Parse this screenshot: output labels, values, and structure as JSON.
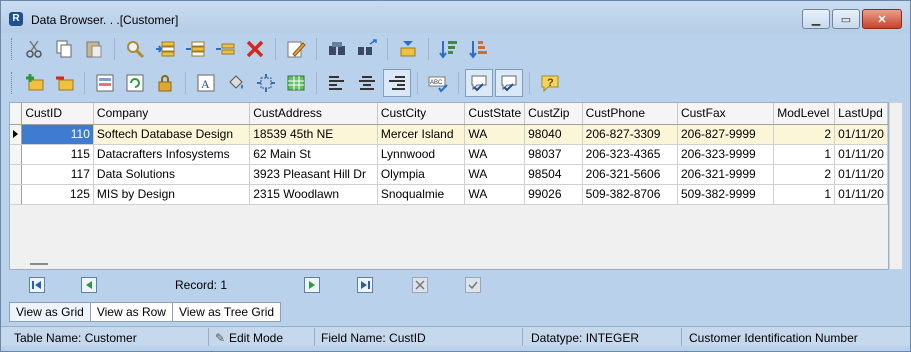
{
  "window": {
    "title": "Data Browser. . .[Customer]"
  },
  "grid": {
    "columns": [
      "CustID",
      "Company",
      "CustAddress",
      "CustCity",
      "CustState",
      "CustZip",
      "CustPhone",
      "CustFax",
      "ModLevel",
      "LastUpd"
    ],
    "rows": [
      [
        "110",
        "Softech Database Design",
        "18539 45th NE",
        "Mercer Island",
        "WA",
        "98040",
        "206-827-3309",
        "206-827-9999",
        "2",
        "01/11/20"
      ],
      [
        "115",
        "Datacrafters Infosystems",
        "62 Main St",
        "Lynnwood",
        "WA",
        "98037",
        "206-323-4365",
        "206-323-9999",
        "1",
        "01/11/20"
      ],
      [
        "117",
        "Data Solutions",
        "3923 Pleasant Hill Dr",
        "Olympia",
        "WA",
        "98504",
        "206-321-5606",
        "206-321-9999",
        "2",
        "01/11/20"
      ],
      [
        "125",
        "MIS by Design",
        "2315 Woodlawn",
        "Snoqualmie",
        "WA",
        "99026",
        "509-382-8706",
        "509-382-9999",
        "1",
        "01/11/20"
      ]
    ]
  },
  "nav": {
    "record_label": "Record: 1"
  },
  "tabs": [
    "View as Grid",
    "View as Row",
    "View as Tree Grid"
  ],
  "status": {
    "table_name": "Table Name: Customer",
    "mode": "Edit Mode",
    "field_name": "Field Name: CustID",
    "datatype": "Datatype: INTEGER",
    "description": "Customer Identification Number"
  }
}
